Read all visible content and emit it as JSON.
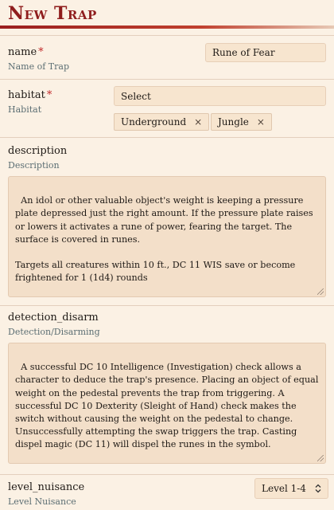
{
  "header": {
    "title": "New Trap"
  },
  "fields": {
    "name": {
      "label": "name",
      "sublabel": "Name of Trap",
      "value": "Rune of Fear"
    },
    "habitat": {
      "label": "habitat",
      "sublabel": "Habitat",
      "select_placeholder": "Select",
      "tags": [
        {
          "label": "Underground",
          "remove": "×"
        },
        {
          "label": "Jungle",
          "remove": "×"
        }
      ]
    },
    "description": {
      "label": "description",
      "sublabel": "Description",
      "value": "An idol or other valuable object's weight is keeping a pressure plate depressed just the right amount. If the pressure plate raises or lowers it activates a rune of power, fearing the target. The surface is covered in runes.\n\nTargets all creatures within 10 ft., DC 11 WIS save or become frightened for 1 (1d4) rounds"
    },
    "detection_disarm": {
      "label": "detection_disarm",
      "sublabel": "Detection/Disarming",
      "value": "A successful DC 10 Intelligence (Investigation) check allows a character to deduce the trap's presence. Placing an object of equal weight on the pedestal prevents the trap from triggering. A successful DC 10 Dexterity (Sleight of Hand) check makes the switch without causing the weight on the pedestal to change. Unsuccessfully attempting the swap triggers the trap. Casting dispel magic (DC 11) will dispel the runes in the symbol."
    },
    "level_nuisance": {
      "label": "level_nuisance",
      "sublabel": "Level Nuisance",
      "value": "Level 1-4"
    }
  },
  "required_marker": "*",
  "colors": {
    "accent": "#8f1d1d",
    "required": "#c22c2c",
    "sublabel": "#5b6e73",
    "field_bg": "#f7e5cf"
  }
}
